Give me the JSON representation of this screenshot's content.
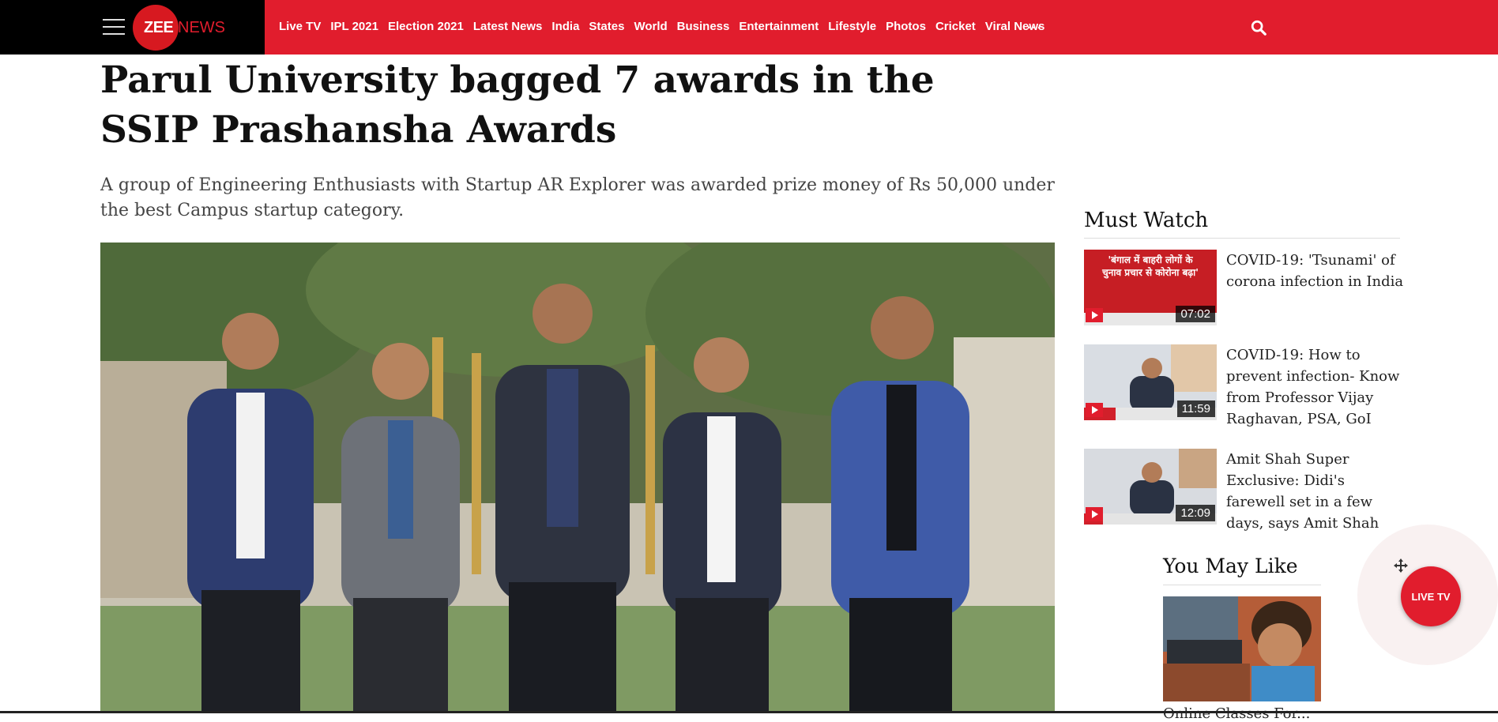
{
  "header": {
    "logo_zee": "ZEE",
    "logo_news": "NEWS",
    "nav": [
      "Live TV",
      "IPL 2021",
      "Election 2021",
      "Latest News",
      "India",
      "States",
      "World",
      "Business",
      "Entertainment",
      "Lifestyle",
      "Photos",
      "Cricket",
      "Viral News"
    ],
    "more": "...",
    "accent_color": "#e11d2d"
  },
  "article": {
    "headline": "Parul University bagged 7 awards in the SSIP Prashansha Awards",
    "summary": "A group of Engineering Enthusiasts with Startup AR Explorer was awarded prize money of Rs 50,000 under the best Campus startup category."
  },
  "must_watch": {
    "title": "Must Watch",
    "videos": [
      {
        "title": "COVID-19: 'Tsunami' of corona infection in India",
        "duration": "07:02",
        "thumb_text": "'बंगाल में बाहरी लोगों के चुनाव प्रचार से कोरोना बढ़ा'"
      },
      {
        "title": "COVID-19: How to prevent infection- Know from Professor Vijay Raghavan, PSA, GoI",
        "duration": "11:59"
      },
      {
        "title": "Amit Shah Super Exclusive: Didi's farewell set in a few days, says Amit Shah",
        "duration": "12:09"
      }
    ]
  },
  "you_may_like": {
    "title": "You May Like",
    "caption": "Online Classes For..."
  },
  "live_tv_button": "LIVE TV"
}
